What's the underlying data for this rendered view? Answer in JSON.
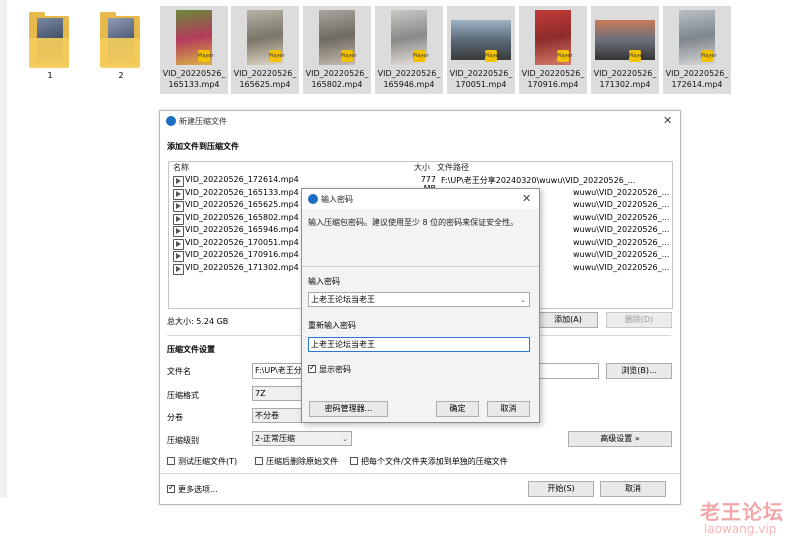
{
  "desktop": {
    "folders": [
      {
        "label": "1"
      },
      {
        "label": "2"
      }
    ],
    "videos": [
      {
        "line1": "VID_20220526_",
        "line2": "165133.mp4",
        "badge": "Player"
      },
      {
        "line1": "VID_20220526_",
        "line2": "165625.mp4",
        "badge": "Player"
      },
      {
        "line1": "VID_20220526_",
        "line2": "165802.mp4",
        "badge": "Player"
      },
      {
        "line1": "VID_20220526_",
        "line2": "165946.mp4",
        "badge": "Player"
      },
      {
        "line1": "VID_20220526_",
        "line2": "170051.mp4",
        "badge": "Player"
      },
      {
        "line1": "VID_20220526_",
        "line2": "170916.mp4",
        "badge": "Player"
      },
      {
        "line1": "VID_20220526_",
        "line2": "171302.mp4",
        "badge": "Player"
      },
      {
        "line1": "VID_20220526_",
        "line2": "172614.mp4",
        "badge": "Player"
      }
    ]
  },
  "main_dialog": {
    "title": "新建压缩文件",
    "section_add": "添加文件到压缩文件",
    "columns": {
      "name": "名称",
      "size": "大小",
      "path": "文件路径"
    },
    "files": [
      {
        "name": "VID_20220526_172614.mp4",
        "size": "777 MB",
        "path": "F:\\UP\\老王分享20240320\\wuwu\\VID_20220526_..."
      },
      {
        "name": "VID_20220526_165133.mp4",
        "size": "",
        "path": "wuwu\\VID_20220526_..."
      },
      {
        "name": "VID_20220526_165625.mp4",
        "size": "",
        "path": "wuwu\\VID_20220526_..."
      },
      {
        "name": "VID_20220526_165802.mp4",
        "size": "",
        "path": "wuwu\\VID_20220526_..."
      },
      {
        "name": "VID_20220526_165946.mp4",
        "size": "",
        "path": "wuwu\\VID_20220526_..."
      },
      {
        "name": "VID_20220526_170051.mp4",
        "size": "",
        "path": "wuwu\\VID_20220526_..."
      },
      {
        "name": "VID_20220526_170916.mp4",
        "size": "",
        "path": "wuwu\\VID_20220526_..."
      },
      {
        "name": "VID_20220526_171302.mp4",
        "size": "",
        "path": "wuwu\\VID_20220526_..."
      }
    ],
    "total_size": "总大小: 5.24 GB",
    "add_button": "添加(A)",
    "delete_button": "删除(D)",
    "settings_title": "压缩文件设置",
    "filename_label": "文件名",
    "filename_value": "F:\\UP\\老王分",
    "browse_button": "浏览(B)...",
    "format_label": "压缩格式",
    "format_value": "7Z",
    "split_label": "分卷",
    "split_value": "不分卷",
    "level_label": "压缩级别",
    "level_value": "2-正常压缩",
    "advanced_button": "高级设置 »",
    "opt_test": "测试压缩文件(T)",
    "opt_delete": "压缩后删除原始文件",
    "opt_each": "把每个文件/文件夹添加到单独的压缩文件",
    "more_options": "更多选项...",
    "start_button": "开始(S)",
    "cancel_button": "取消"
  },
  "password_dialog": {
    "title": "输入密码",
    "hint": "输入压缩包密码。建议使用至少 8 位的密码来保证安全性。",
    "enter_label": "输入密码",
    "enter_value": "上老王论坛当老王",
    "reenter_label": "重新输入密码",
    "reenter_value": "上老王论坛当老王",
    "show_password": "显示密码",
    "manager_button": "密码管理器...",
    "ok_button": "确定",
    "cancel_button": "取消"
  },
  "watermark": {
    "text1": "老王论坛",
    "text2": "laowang.vip"
  }
}
